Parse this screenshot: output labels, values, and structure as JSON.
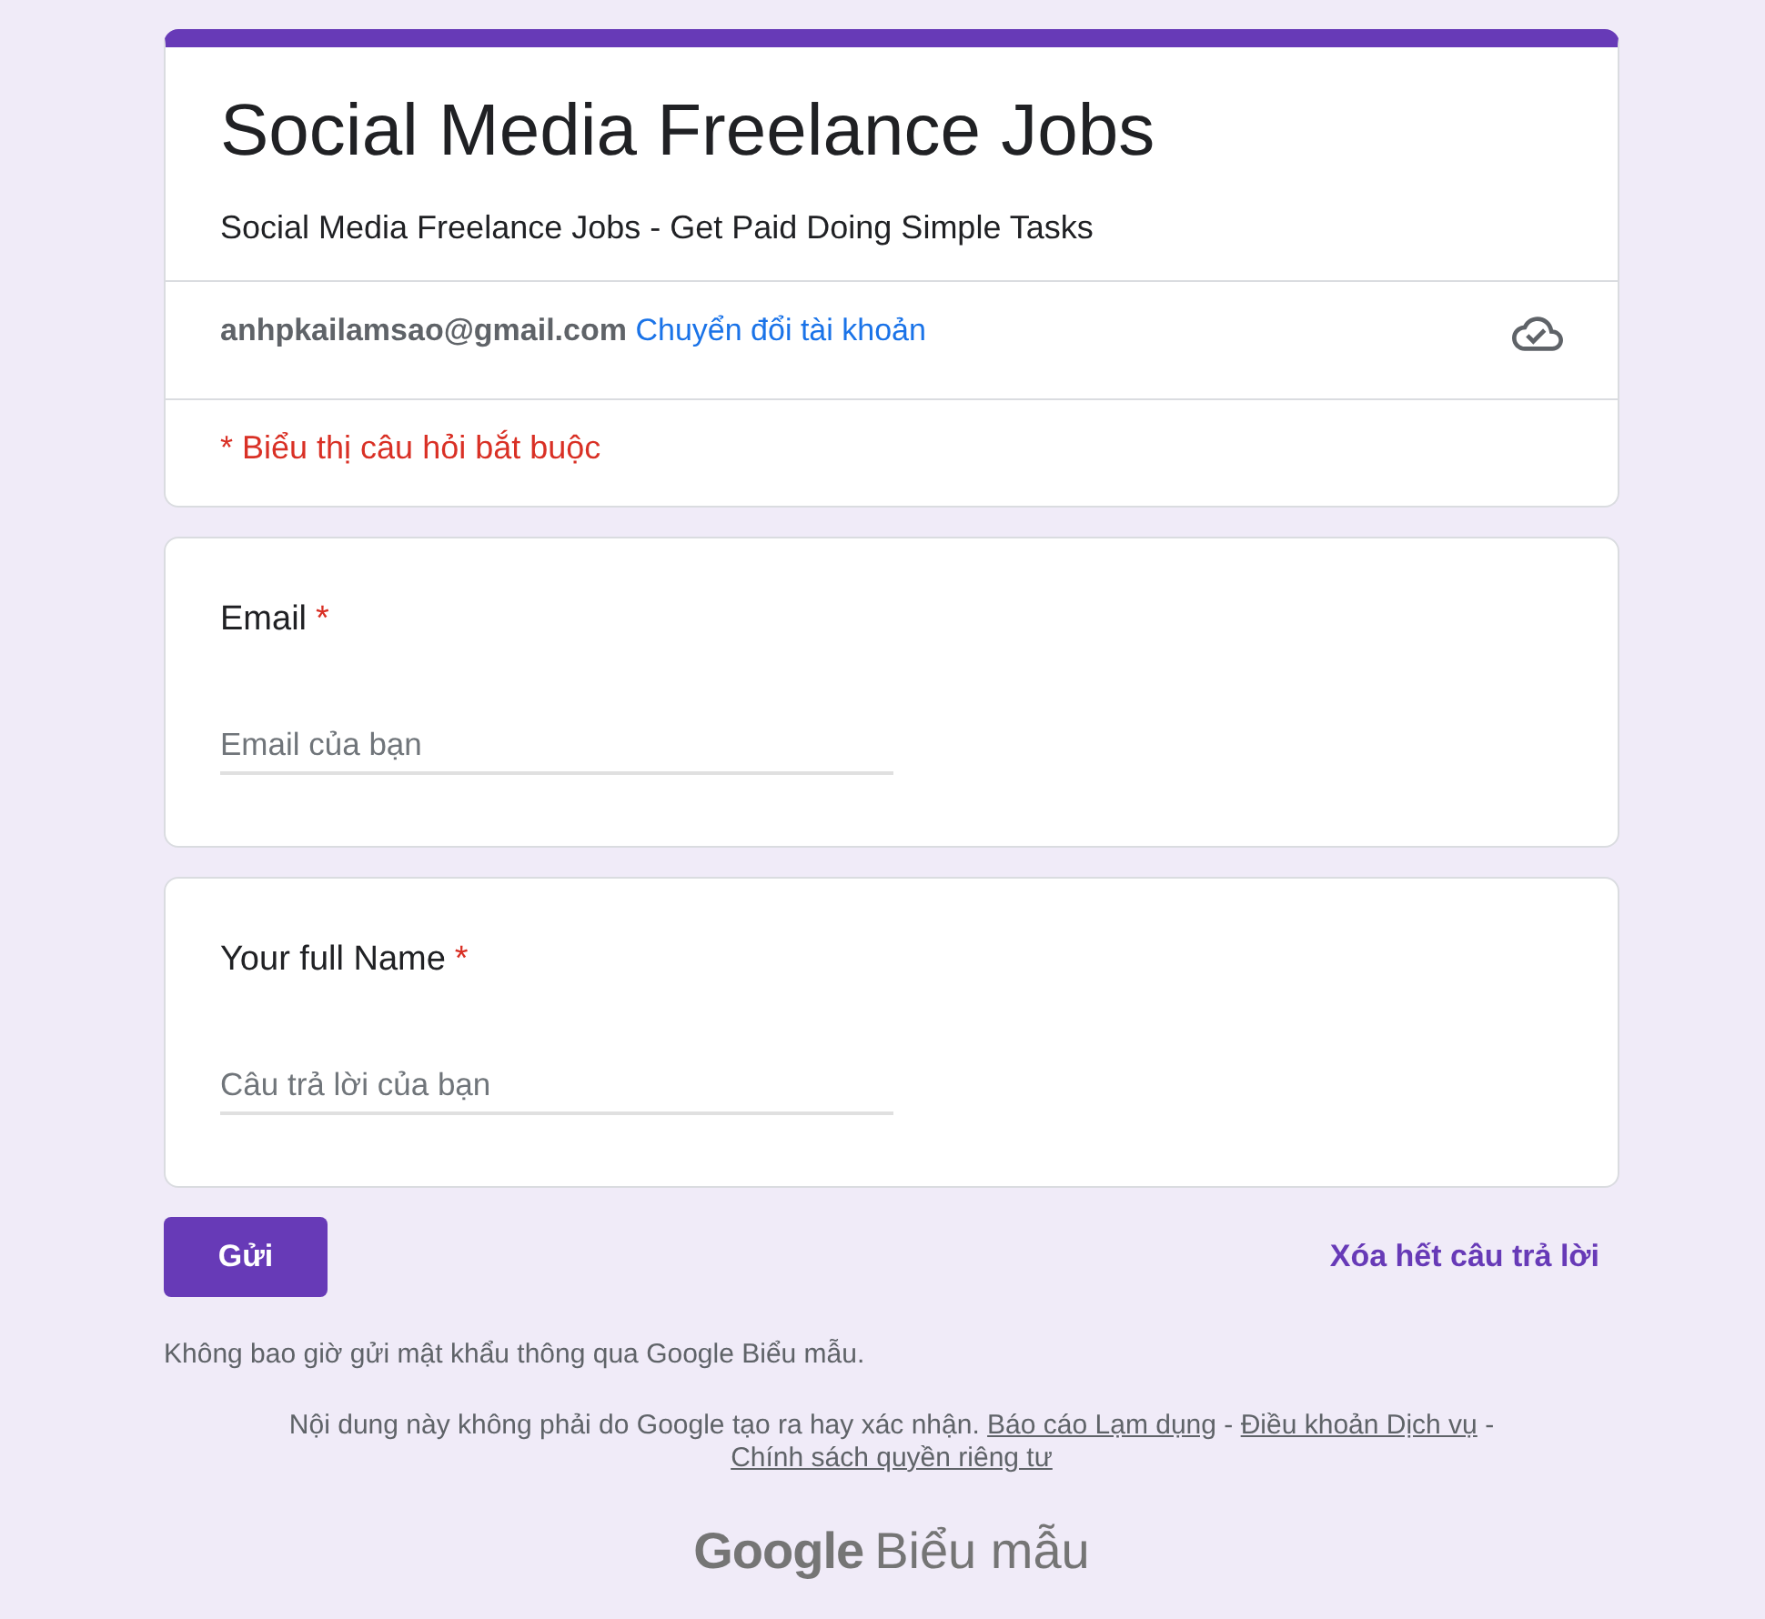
{
  "header": {
    "title": "Social Media Freelance Jobs",
    "description": "Social Media Freelance Jobs - Get Paid Doing Simple Tasks"
  },
  "account": {
    "email": "anhpkailamsao@gmail.com",
    "switch_link": "Chuyển đổi tài khoản"
  },
  "required_note": "* Biểu thị câu hỏi bắt buộc",
  "questions": [
    {
      "label": "Email",
      "required": true,
      "required_mark": "*",
      "placeholder": "Email của bạn"
    },
    {
      "label": "Your full Name",
      "required": true,
      "required_mark": "*",
      "placeholder": "Câu trả lời của bạn"
    }
  ],
  "actions": {
    "submit": "Gửi",
    "clear": "Xóa hết câu trả lời"
  },
  "password_warning": "Không bao giờ gửi mật khẩu thông qua Google Biểu mẫu.",
  "disclaimer": [
    {
      "kind": "text",
      "text": "Nội dung này không phải do Google tạo ra hay xác nhận."
    },
    {
      "kind": "link",
      "text": "Báo cáo Lạm dụng"
    },
    {
      "kind": "separator",
      "text": "-"
    },
    {
      "kind": "link",
      "text": "Điều khoản Dịch vụ"
    },
    {
      "kind": "separator",
      "text": "-"
    },
    {
      "kind": "link",
      "text": "Chính sách quyền riêng tư"
    }
  ],
  "logo": {
    "brand": "Google",
    "product": "Biểu mẫu"
  }
}
